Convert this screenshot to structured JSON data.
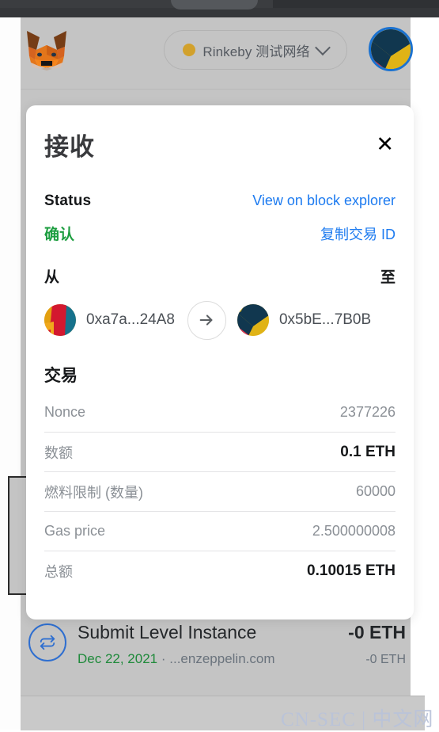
{
  "browser": {
    "chrome_color": "#3b3d40"
  },
  "header": {
    "logo_name": "metamask-fox-logo",
    "network": {
      "label": "Rinkeby 测试网络",
      "dot_color": "#d2a12c",
      "chevron": "chevron-down-icon"
    },
    "account_avatar": "account-jazzicon",
    "ring_color": "#1b72d0"
  },
  "modal": {
    "title": "接收",
    "close_label": "✕",
    "status": {
      "label": "Status",
      "explorer_link": "View on block explorer",
      "value": "确认",
      "value_color": "#1e9e41",
      "copy_link": "复制交易 ID"
    },
    "transfer": {
      "from_label": "从",
      "to_label": "至",
      "from_address": "0xa7a...24A8",
      "to_address": "0x5bE...7B0B",
      "arrow_icon": "arrow-right-icon"
    },
    "details": {
      "section_title": "交易",
      "rows": [
        {
          "key": "Nonce",
          "value": "2377226",
          "emphasis": false
        },
        {
          "key": "数额",
          "value": "0.1 ETH",
          "emphasis": true
        },
        {
          "key": "燃料限制 (数量)",
          "value": "60000",
          "emphasis": false
        },
        {
          "key": "Gas price",
          "value": "2.500000008",
          "emphasis": false
        },
        {
          "key": "总额",
          "value": "0.10015 ETH",
          "emphasis": true
        }
      ]
    }
  },
  "background_transaction": {
    "icon": "swap-icon",
    "title": "Submit Level Instance",
    "date": "Dec 22, 2021",
    "separator": " · ",
    "site": "...enzeppelin.com",
    "amount": "-0 ETH",
    "amount_secondary": "-0 ETH",
    "date_color": "#1f8a3b"
  },
  "watermark": {
    "text": "CN-SEC | 中文网"
  }
}
